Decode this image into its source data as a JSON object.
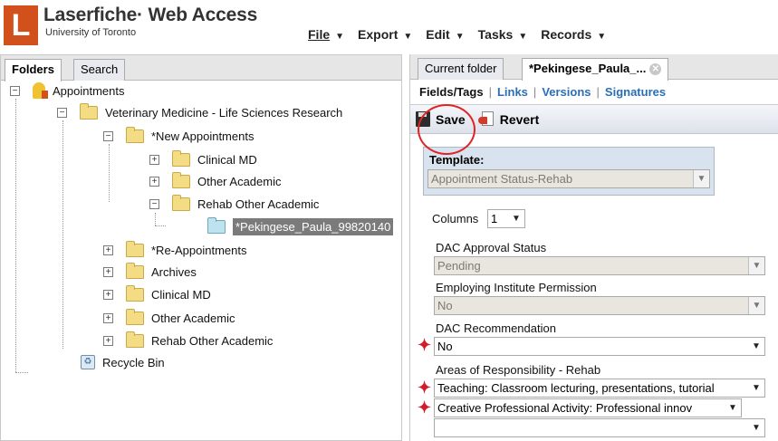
{
  "header": {
    "brand": "Laserfiche· Web Access",
    "logo_letter": "L",
    "subbrand": "University of Toronto"
  },
  "menu": [
    {
      "label": "File"
    },
    {
      "label": "Export"
    },
    {
      "label": "Edit"
    },
    {
      "label": "Tasks"
    },
    {
      "label": "Records"
    }
  ],
  "left_tabs": {
    "folders": "Folders",
    "search": "Search"
  },
  "tree": {
    "root": "Appointments",
    "vet": "Veterinary Medicine - Life Sciences Research",
    "new_appts": "*New Appointments",
    "clinical_md_1": "Clinical MD",
    "other_academic_1": "Other Academic",
    "rehab_other_1": "Rehab Other Academic",
    "selected_doc": "*Pekingese_Paula_99820140",
    "re_appts": "*Re-Appointments",
    "archives": "Archives",
    "clinical_md_2": "Clinical MD",
    "other_academic_2": "Other Academic",
    "rehab_other_2": "Rehab Other Academic",
    "recycle_bin": "Recycle Bin"
  },
  "right_tabs": {
    "current_folder": "Current folder",
    "document": "*Pekingese_Paula_..."
  },
  "subnav": {
    "fields_tags": "Fields/Tags",
    "links": "Links",
    "versions": "Versions",
    "signatures": "Signatures"
  },
  "toolbar": {
    "save": "Save",
    "revert": "Revert"
  },
  "form": {
    "template_label": "Template:",
    "template_value": "Appointment Status-Rehab",
    "columns_label": "Columns",
    "columns_value": "1",
    "dac_approval_label": "DAC Approval Status",
    "dac_approval_value": "Pending",
    "employing_label": "Employing Institute Permission",
    "employing_value": "No",
    "dac_rec_label": "DAC Recommendation",
    "dac_rec_value": "No",
    "areas_label": "Areas of Responsibility - Rehab",
    "areas_value_1": "Teaching: Classroom lecturing, presentations, tutorial",
    "areas_value_2": "Creative Professional Activity: Professional innov",
    "areas_value_3": ""
  },
  "colors": {
    "brand_orange": "#d2501c",
    "link_blue": "#2a6fb5",
    "required_red": "#d21e2b",
    "selected_gray": "#7b7b7b"
  }
}
